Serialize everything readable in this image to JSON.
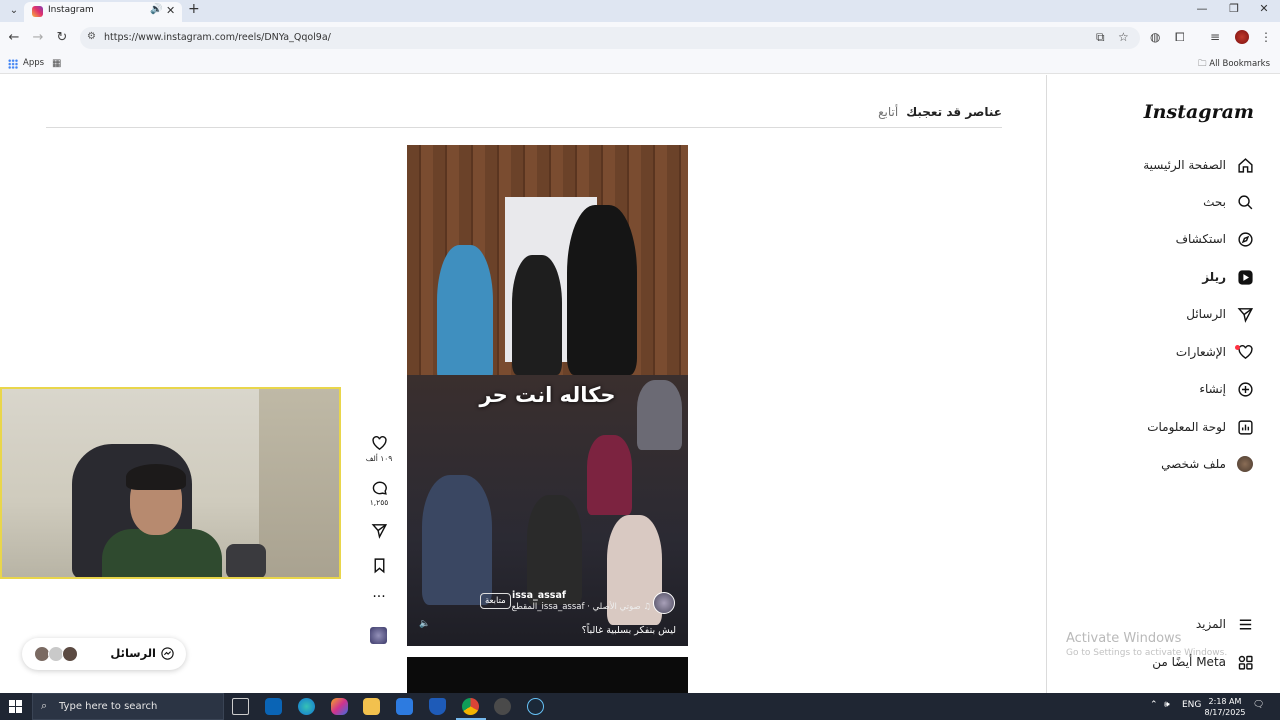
{
  "browser": {
    "tab_title": "Instagram",
    "url": "https://www.instagram.com/reels/DNYa_Qqol9a/",
    "bookmarks": {
      "apps_label": "Apps",
      "all_bookmarks_label": "All Bookmarks"
    }
  },
  "sidebar": {
    "logo": "Instagram",
    "items": [
      {
        "label": "الصفحة الرئيسية",
        "icon": "home-icon"
      },
      {
        "label": "بحث",
        "icon": "search-icon"
      },
      {
        "label": "استكشاف",
        "icon": "compass-icon"
      },
      {
        "label": "ريلز",
        "icon": "reels-icon",
        "active": true
      },
      {
        "label": "الرسائل",
        "icon": "messages-icon"
      },
      {
        "label": "الإشعارات",
        "icon": "heart-icon",
        "has_dot": true
      },
      {
        "label": "إنشاء",
        "icon": "create-icon"
      },
      {
        "label": "لوحة المعلومات",
        "icon": "dashboard-icon"
      },
      {
        "label": "ملف شخصي",
        "icon": "profile-avatar"
      }
    ],
    "more_label": "المزيد",
    "meta_label": "أيضًا من Meta"
  },
  "feed": {
    "tab_active": "عناصر قد تعجبك",
    "tab_following": "أتابع"
  },
  "reel": {
    "overlay_text": "حكاله انت حر",
    "username": "issa_assaf",
    "follow_label": "متابعة",
    "audio_text": "♫ صوتي الأصلي · issa_assaf_المقطع",
    "description": "ليش بتفكر بسلبية غالباً؟",
    "likes": "١٠٩ ألف",
    "comments": "١,٢٥٥"
  },
  "messages_pill": {
    "label": "الرسائل"
  },
  "watermark": {
    "line1": "Activate Windows",
    "line2": "Go to Settings to activate Windows."
  },
  "taskbar": {
    "search_placeholder": "Type here to search",
    "language": "ENG",
    "time": "2:18 AM",
    "date": "8/17/2025"
  },
  "colors": {
    "tabstrip": "#dfe6f2",
    "taskbar": "#1f2633",
    "notification_dot": "#ff3040",
    "webcam_border": "#e9d64b"
  }
}
